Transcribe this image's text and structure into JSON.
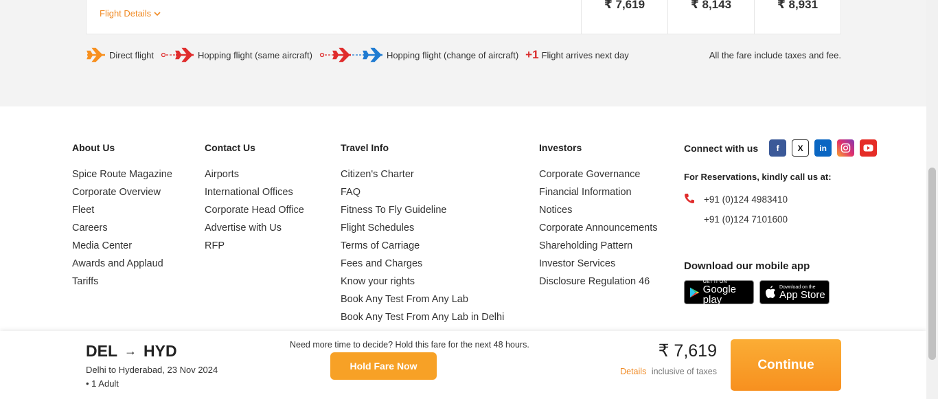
{
  "fare_card": {
    "flight_details_label": "Flight Details",
    "prices": [
      "₹ 7,619",
      "₹ 8,143",
      "₹ 8,931"
    ]
  },
  "legend": {
    "direct": "Direct flight",
    "hopping_same": "Hopping flight (same aircraft)",
    "hopping_change": "Hopping flight (change of aircraft)",
    "plus_one": "+1",
    "next_day": "Flight arrives next day",
    "fare_note": "All the fare include taxes and fee."
  },
  "footer": {
    "about": {
      "title": "About Us",
      "items": [
        "Spice Route Magazine",
        "Corporate Overview",
        "Fleet",
        "Careers",
        "Media Center",
        "Awards and Applaud",
        "Tariffs"
      ]
    },
    "contact": {
      "title": "Contact Us",
      "items": [
        "Airports",
        "International Offices",
        "Corporate Head Office",
        "Advertise with Us",
        "RFP"
      ]
    },
    "travel": {
      "title": "Travel Info",
      "items": [
        "Citizen's Charter",
        "FAQ",
        "Fitness To Fly Guideline",
        "Flight Schedules",
        "Terms of Carriage",
        "Fees and Charges",
        "Know your rights",
        "Book Any Test From Any Lab",
        "Book Any Test From Any Lab in Delhi"
      ]
    },
    "investors": {
      "title": "Investors",
      "items": [
        "Corporate Governance",
        "Financial Information",
        "Notices",
        "Corporate Announcements",
        "Shareholding Pattern",
        "Investor Services",
        "Disclosure Regulation 46"
      ]
    },
    "connect": {
      "title": "Connect with us",
      "social": [
        "facebook-icon",
        "x-icon",
        "linkedin-icon",
        "instagram-icon",
        "youtube-icon"
      ],
      "reservations_title": "For Reservations, kindly call us at:",
      "phone1": "+91 (0)124 4983410",
      "phone2": "+91 (0)124 7101600",
      "download_title": "Download our mobile app",
      "google_small": "GET IT ON",
      "google_big": "Google play",
      "apple_small": "Download on the",
      "apple_big": "App Store"
    }
  },
  "bottom_bar": {
    "origin": "DEL",
    "destination": "HYD",
    "arrow": "→",
    "route_text": "Delhi to Hyderabad, 23 Nov 2024",
    "pax": "• 1 Adult",
    "hold_note": "Need more time to decide? Hold this fare for the next 48 hours.",
    "hold_button": "Hold Fare Now",
    "total_price": "₹ 7,619",
    "details_link": "Details",
    "inclusive": "inclusive of taxes",
    "continue_button": "Continue"
  },
  "colors": {
    "accent": "#f7a126",
    "link": "#f08a24",
    "facebook": "#3b5998",
    "x": "#222222",
    "linkedin": "#0a66c2",
    "youtube": "#e52d27"
  }
}
